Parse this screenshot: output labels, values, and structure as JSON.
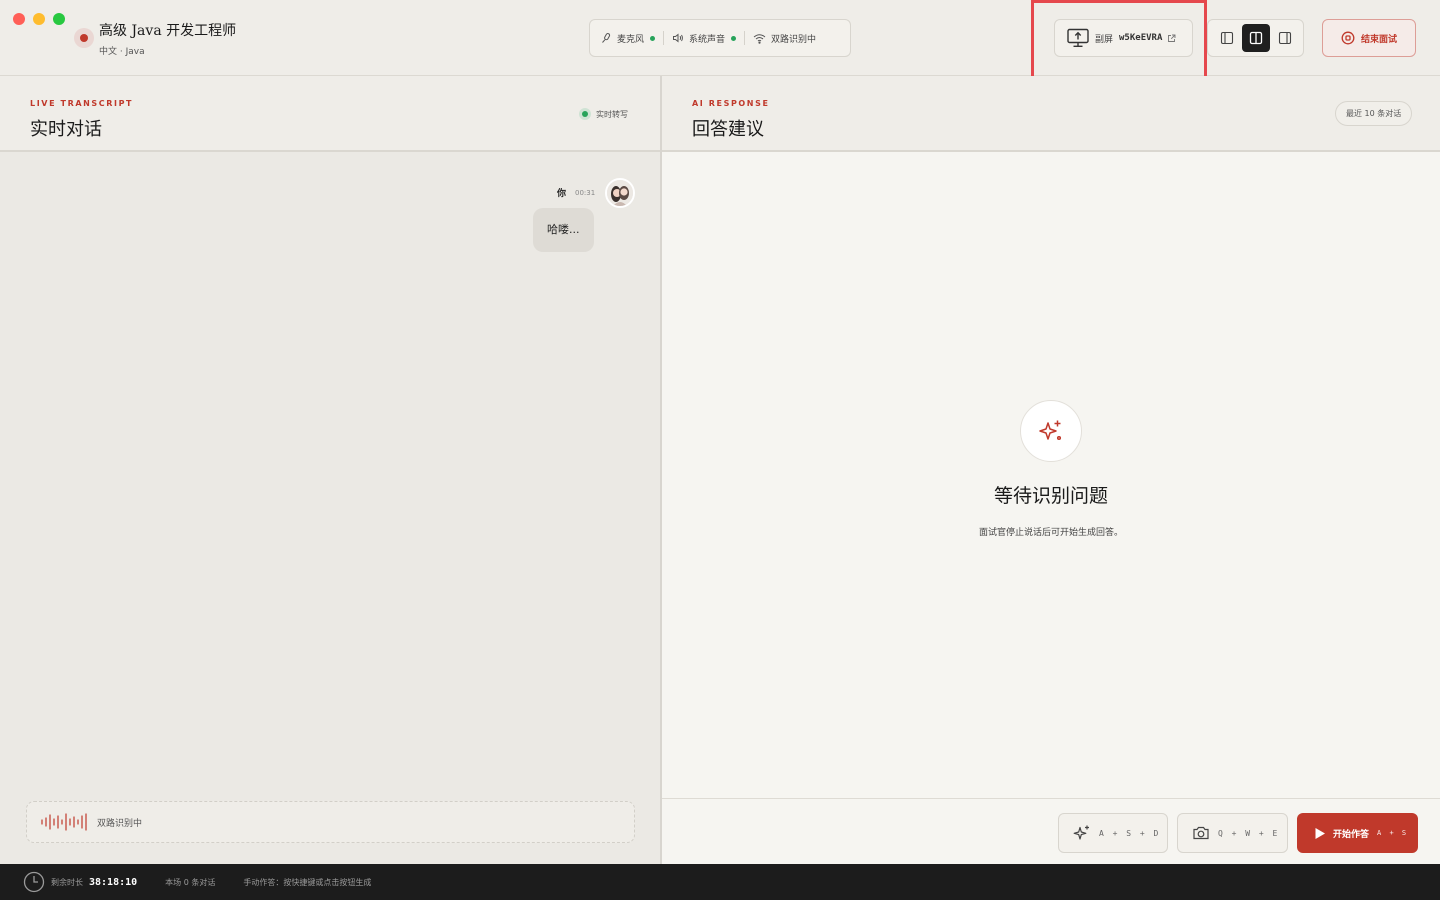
{
  "header": {
    "title": "高级 Java 开发工程师",
    "subtitle": "中文 · Java",
    "audio": {
      "mic_label": "麦克风",
      "system_audio_label": "系统声音",
      "dual_label": "双路识别中"
    },
    "screen_share": {
      "label": "副屏",
      "code": "w5KeEVRA"
    },
    "end_button_label": "结束面试",
    "colors": {
      "accent": "#c0392b",
      "status_ok": "#27a35a",
      "highlight": "#e5484d"
    }
  },
  "transcript": {
    "eyebrow": "LIVE TRANSCRIPT",
    "title": "实时对话",
    "live_status": "实时转写",
    "messages": [
      {
        "speaker": "你",
        "time": "00:31",
        "text": "哈喽..."
      }
    ],
    "listening_label": "双路识别中"
  },
  "response": {
    "eyebrow": "AI RESPONSE",
    "title": "回答建议",
    "recent_label": "最近 10 条对话",
    "empty_title": "等待识别问题",
    "empty_subtitle": "面试官停止说话后可开始生成回答。",
    "actions": {
      "ai_keys": "A + S + D",
      "screenshot_keys": "Q + W + E",
      "start_label": "开始作答",
      "start_keys": "A + S"
    }
  },
  "footer": {
    "remaining_label": "剩余时长",
    "remaining_time": "38:18:10",
    "count_label": "本场 0 条对话",
    "hint": "手动作答：按快捷键或点击按钮生成"
  }
}
